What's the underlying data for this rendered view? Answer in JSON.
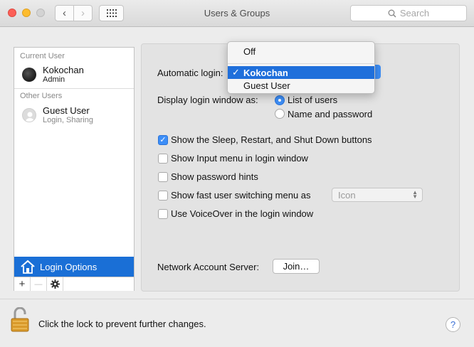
{
  "window": {
    "title": "Users & Groups"
  },
  "toolbar": {
    "back_glyph": "‹",
    "forward_glyph": "›",
    "search_placeholder": "Search"
  },
  "sidebar": {
    "current_user_header": "Current User",
    "other_users_header": "Other Users",
    "current_user": {
      "name": "Kokochan",
      "role": "Admin"
    },
    "other_users": [
      {
        "name": "Guest User",
        "role": "Login, Sharing"
      }
    ],
    "login_options_label": "Login Options",
    "footer": {
      "add": "+",
      "remove": "—"
    }
  },
  "panel": {
    "automatic_login_label": "Automatic login:",
    "display_login_label": "Display login window as:",
    "display_options": [
      {
        "label": "List of users",
        "selected": true
      },
      {
        "label": "Name and password",
        "selected": false
      }
    ],
    "checkboxes": [
      {
        "label": "Show the Sleep, Restart, and Shut Down buttons",
        "checked": true
      },
      {
        "label": "Show Input menu in login window",
        "checked": false
      },
      {
        "label": "Show password hints",
        "checked": false
      },
      {
        "label": "Show fast user switching menu as",
        "checked": false
      },
      {
        "label": "Use VoiceOver in the login window",
        "checked": false
      }
    ],
    "fast_switch_popup_value": "Icon",
    "network_server_label": "Network Account Server:",
    "join_button": "Join…"
  },
  "autologin_menu": {
    "items": [
      {
        "label": "Off",
        "selected": false
      },
      {
        "label": "Kokochan",
        "selected": true
      },
      {
        "label": "Guest User",
        "selected": false
      }
    ],
    "checkmark": "✓"
  },
  "footer": {
    "lock_text": "Click the lock to prevent further changes.",
    "help": "?"
  },
  "colors": {
    "accent": "#1a6fd6",
    "checkbox_on": "#3d8ef7"
  }
}
